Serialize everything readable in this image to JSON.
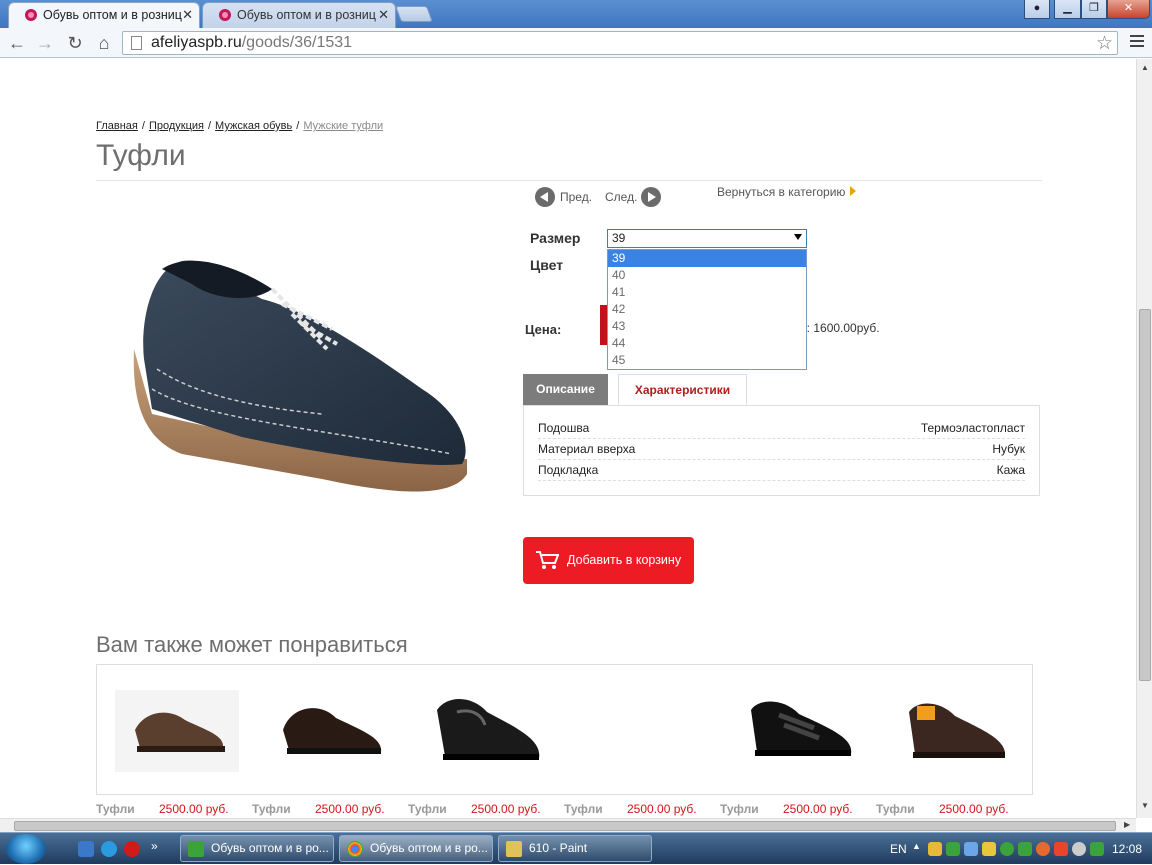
{
  "browser": {
    "tabs": [
      {
        "title": "Обувь оптом и в розниц",
        "active": true
      },
      {
        "title": "Обувь оптом и в розниц",
        "active": false
      }
    ],
    "url_host": "afeliyaspb.ru",
    "url_path": "/goods/36/1531"
  },
  "breadcrumb": [
    {
      "label": "Главная"
    },
    {
      "label": "Продукция"
    },
    {
      "label": "Мужская обувь"
    },
    {
      "label": "Мужские туфли",
      "current": true
    }
  ],
  "product": {
    "title": "Туфли",
    "prev_label": "Пред.",
    "next_label": "След.",
    "back_label": "Вернуться в категорию",
    "size_label": "Размер",
    "color_label": "Цвет",
    "price_label": "Цена:",
    "price_partial": "р: 1600.00руб.",
    "size_select": {
      "selected": "39",
      "options": [
        "39",
        "40",
        "41",
        "42",
        "43",
        "44",
        "45"
      ],
      "highlighted": "39"
    },
    "tabs": [
      {
        "label": "Описание",
        "active": false
      },
      {
        "label": "Характеристики",
        "active": true
      }
    ],
    "specs": [
      {
        "name": "Подошва",
        "value": "Термоэластопласт"
      },
      {
        "name": "Материал вверха",
        "value": "Нубук"
      },
      {
        "name": "Подкладка",
        "value": "Кажа"
      }
    ],
    "add_to_cart_label": "Добавить в корзину"
  },
  "related": {
    "title": "Вам также может понравиться",
    "items": [
      {
        "name": "Туфли",
        "price": "2500.00 руб."
      },
      {
        "name": "Туфли",
        "price": "2500.00 руб."
      },
      {
        "name": "Туфли",
        "price": "2500.00 руб."
      },
      {
        "name": "Туфли",
        "price": "2500.00 руб."
      },
      {
        "name": "Туфли",
        "price": "2500.00 руб."
      },
      {
        "name": "Туфли",
        "price": "2500.00 руб."
      }
    ]
  },
  "taskbar": {
    "tasks": [
      {
        "label": "Обувь оптом и в ро..."
      },
      {
        "label": "Обувь оптом и в ро..."
      },
      {
        "label": "610 - Paint"
      }
    ],
    "lang": "EN",
    "clock": "12:08"
  },
  "colors": {
    "accent_red": "#ed1c24",
    "price_red": "#d4141a",
    "tab_gray": "#7c7c7c",
    "select_highlight": "#3b83e2"
  }
}
